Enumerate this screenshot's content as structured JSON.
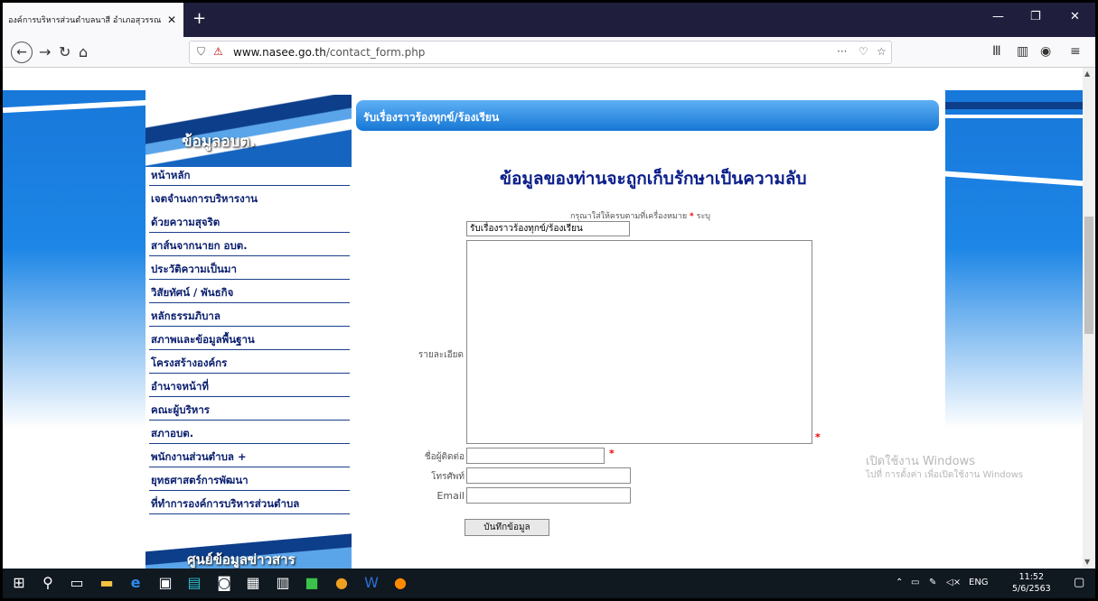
{
  "browser": {
    "tab_title": "องค์การบริหารส่วนตำบลนาสี อำเภอสุวรรณ",
    "tab_close": "✕",
    "new_tab": "+",
    "url_domain": "www.nasee.go.th",
    "url_path": "/contact_form.php",
    "url_menu": "···",
    "window_controls": [
      "—",
      "❐",
      "✕"
    ]
  },
  "sidebar": {
    "header_title": "ข้อมูลอบต.",
    "items": [
      "หน้าหลัก",
      "เจตจำนงการบริหารงาน",
      "ด้วยความสุจริต",
      "สาส์นจากนายก อบต.",
      "ประวัติความเป็นมา",
      "วิสัยทัศน์ / พันธกิจ",
      "หลักธรรมภิบาล",
      "สภาพและข้อมูลพื้นฐาน",
      "โครงสร้างองค์กร",
      "อำนาจหน้าที่",
      "คณะผู้บริหาร",
      "สภาอบต.",
      "พนักงานส่วนตำบล +",
      "ยุทธศาสตร์การพัฒนา",
      "ที่ทำการองค์การบริหารส่วนตำบล"
    ],
    "footer_title": "ศูนย์ข้อมูลข่าวสาร"
  },
  "content": {
    "bar_title": "รับเรื่องราวร้องทุกข์/ร้องเรียน",
    "heading": "ข้อมูลของท่านจะถูกเก็บรักษาเป็นความลับ",
    "hint_before": "กรุณาใส่ให้ครบตามที่เครื่องหมาย",
    "hint_star": "*",
    "hint_after": "ระบุ",
    "subject_value": "รับเรื่องราวร้องทุกข์/ร้องเรียน",
    "detail_label": "รายละเอียด",
    "detail_value": "",
    "contact_label": "ชื่อผู้ติดต่อ",
    "contact_value": "",
    "phone_label": "โทรศัพท์",
    "phone_value": "",
    "email_label": "Email",
    "email_value": "",
    "required_star": "*",
    "submit_label": "บันทึกข้อมูล"
  },
  "watermark": {
    "line1": "เปิดใช้งาน Windows",
    "line2": "ไปที่ การตั้งค่า เพื่อเปิดใช้งาน Windows"
  },
  "taskbar": {
    "tray_lang": "ENG",
    "time": "11:52",
    "date": "5/6/2563"
  }
}
